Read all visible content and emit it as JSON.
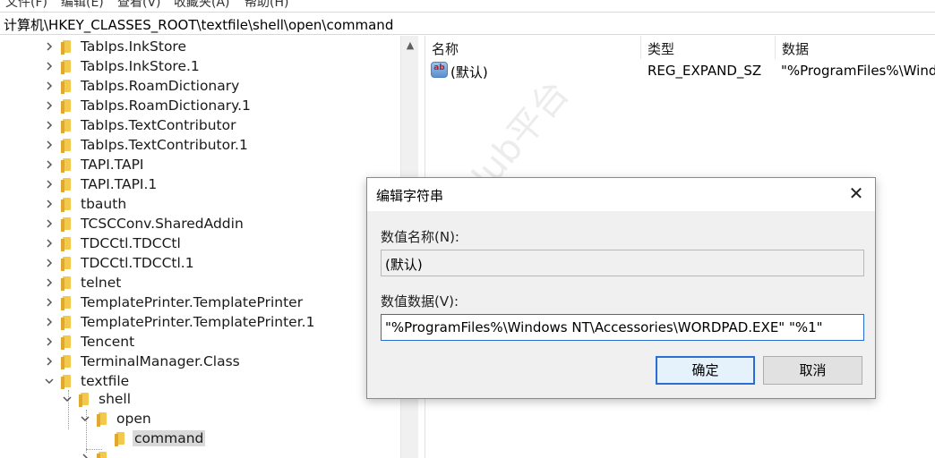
{
  "menubar": {
    "items": [
      "文件(F)",
      "编辑(E)",
      "查看(V)",
      "收藏夹(A)",
      "帮助(H)"
    ]
  },
  "address": "计算机\\HKEY_CLASSES_ROOT\\textfile\\shell\\open\\command",
  "tree": {
    "items": [
      "TabIps.InkStore",
      "TabIps.InkStore.1",
      "TabIps.RoamDictionary",
      "TabIps.RoamDictionary.1",
      "TabIps.TextContributor",
      "TabIps.TextContributor.1",
      "TAPI.TAPI",
      "TAPI.TAPI.1",
      "tbauth",
      "TCSCConv.SharedAddin",
      "TDCCtl.TDCCtl",
      "TDCCtl.TDCCtl.1",
      "telnet",
      "TemplatePrinter.TemplatePrinter",
      "TemplatePrinter.TemplatePrinter.1",
      "Tencent",
      "TerminalManager.Class",
      "textfile"
    ],
    "child1": "shell",
    "child2": "open",
    "child3": "command"
  },
  "scroll": {
    "up_glyph": "▲"
  },
  "list": {
    "headers": {
      "name": "名称",
      "type": "类型",
      "data": "数据"
    },
    "row": {
      "name": "(默认)",
      "type": "REG_EXPAND_SZ",
      "data": "\"%ProgramFiles%\\Wind",
      "icon_text": "ab"
    }
  },
  "watermark": "secHub平台",
  "dialog": {
    "title": "编辑字符串",
    "close_glyph": "✕",
    "name_label": "数值名称(N):",
    "name_value": "(默认)",
    "data_label": "数值数据(V):",
    "data_value": "\"%ProgramFiles%\\Windows NT\\Accessories\\WORDPAD.EXE\" \"%1\"",
    "ok_label": "确定",
    "cancel_label": "取消"
  }
}
